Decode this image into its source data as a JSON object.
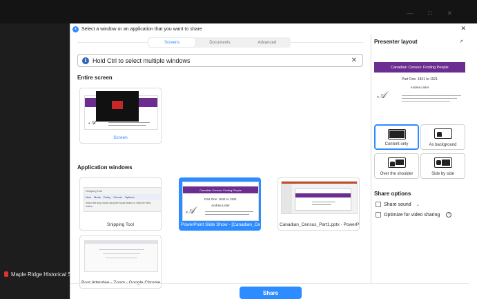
{
  "background": {
    "meeting_label": "Maple Ridge Historical S"
  },
  "dialog": {
    "title": "Select a window or an application that you want to share",
    "tabs": [
      "Screens",
      "Documents",
      "Advanced"
    ],
    "active_tab": "Screens",
    "hint": "Hold Ctrl to select multiple windows",
    "entire_screen_heading": "Entire screen",
    "screen_label": "Screen",
    "app_windows_heading": "Application windows",
    "windows": [
      {
        "label": "Snipping Tool"
      },
      {
        "label": "PowerPoint Slide Show - [Canadian_Ce..."
      },
      {
        "label": "Canadian_Census_Part1.pptx - PowerP..."
      },
      {
        "label": "Post Attendee - Zoom - Google Chrome"
      }
    ],
    "selected_window": "PowerPoint Slide Show - [Canadian_Ce...",
    "share_button": "Share"
  },
  "thumbnails": {
    "slide_title": "Canadian Census: Finding People",
    "slide_subtitle": "Part One: 1841 to 1921",
    "slide_author": "Andrea Lister",
    "snip_title": "Snipping Tool",
    "snip_toolbar": [
      "New",
      "Mode",
      "Delay",
      "Cancel",
      "Options"
    ],
    "snip_text": "Select the snip mode using the Mode button or click the New button."
  },
  "presenter": {
    "heading": "Presenter layout",
    "preview_title": "Canadian Census: Finding People",
    "preview_subtitle": "Part One: 1841 to 1921",
    "preview_author": "Andrea Lister",
    "layouts": [
      "Content only",
      "As background",
      "Over the shoulder",
      "Side by side"
    ],
    "selected_layout": "Content only"
  },
  "share_options": {
    "heading": "Share options",
    "share_sound": "Share sound",
    "optimize_video": "Optimize for video sharing"
  },
  "colors": {
    "accent": "#2d8cff",
    "slide_purple": "#6b2d8f"
  }
}
